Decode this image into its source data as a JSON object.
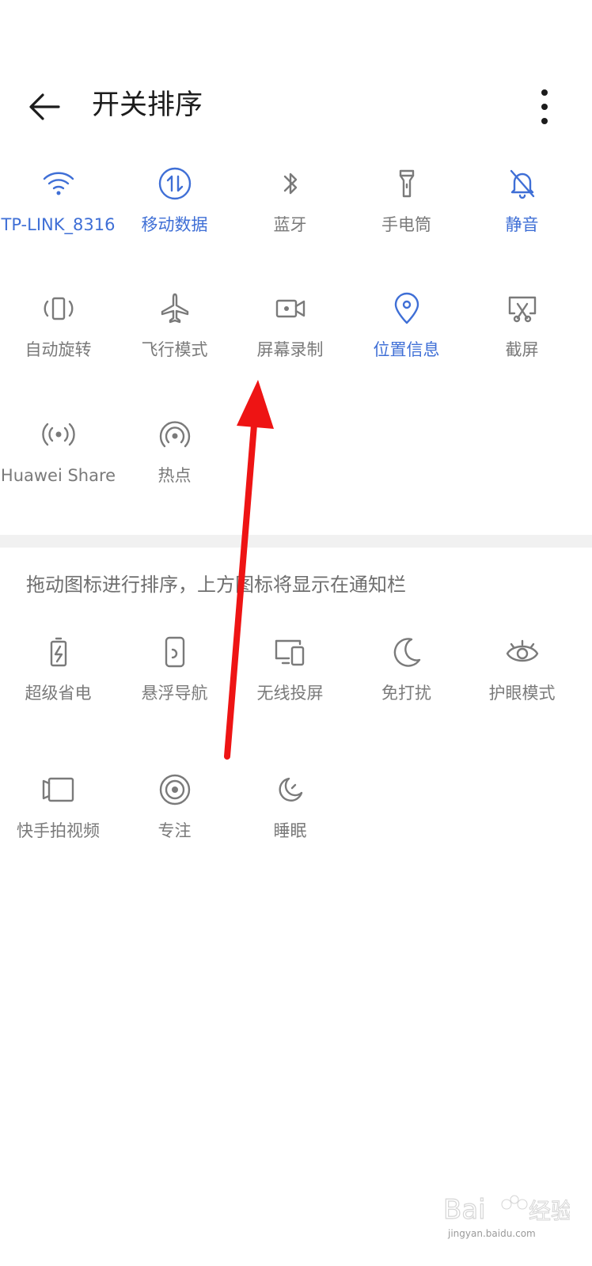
{
  "header": {
    "title": "开关排序"
  },
  "colors": {
    "active": "#3f6fd6",
    "inactive": "#7a7a7a",
    "arrow": "#ee1414"
  },
  "active_tiles": [
    {
      "label": "TP-LINK_8316",
      "icon": "wifi-icon",
      "on": true
    },
    {
      "label": "移动数据",
      "icon": "mobile-data-icon",
      "on": true
    },
    {
      "label": "蓝牙",
      "icon": "bluetooth-icon",
      "on": false
    },
    {
      "label": "手电筒",
      "icon": "flashlight-icon",
      "on": false
    },
    {
      "label": "静音",
      "icon": "silent-bell-icon",
      "on": true
    },
    {
      "label": "自动旋转",
      "icon": "auto-rotate-icon",
      "on": false
    },
    {
      "label": "飞行模式",
      "icon": "airplane-icon",
      "on": false
    },
    {
      "label": "屏幕录制",
      "icon": "screen-record-icon",
      "on": false
    },
    {
      "label": "位置信息",
      "icon": "location-icon",
      "on": true
    },
    {
      "label": "截屏",
      "icon": "screenshot-icon",
      "on": false
    },
    {
      "label": "Huawei Share",
      "icon": "huawei-share-icon",
      "on": false
    },
    {
      "label": "热点",
      "icon": "hotspot-icon",
      "on": false
    }
  ],
  "hint": "拖动图标进行排序，上方图标将显示在通知栏",
  "other_tiles": [
    {
      "label": "超级省电",
      "icon": "battery-saver-icon"
    },
    {
      "label": "悬浮导航",
      "icon": "floating-nav-icon"
    },
    {
      "label": "无线投屏",
      "icon": "wireless-projection-icon"
    },
    {
      "label": "免打扰",
      "icon": "do-not-disturb-icon"
    },
    {
      "label": "护眼模式",
      "icon": "eye-comfort-icon"
    },
    {
      "label": "快手拍视频",
      "icon": "video-capture-icon"
    },
    {
      "label": "专注",
      "icon": "focus-icon"
    },
    {
      "label": "睡眠",
      "icon": "sleep-icon"
    }
  ],
  "watermark": {
    "text": "jingyan.baidu.com"
  }
}
